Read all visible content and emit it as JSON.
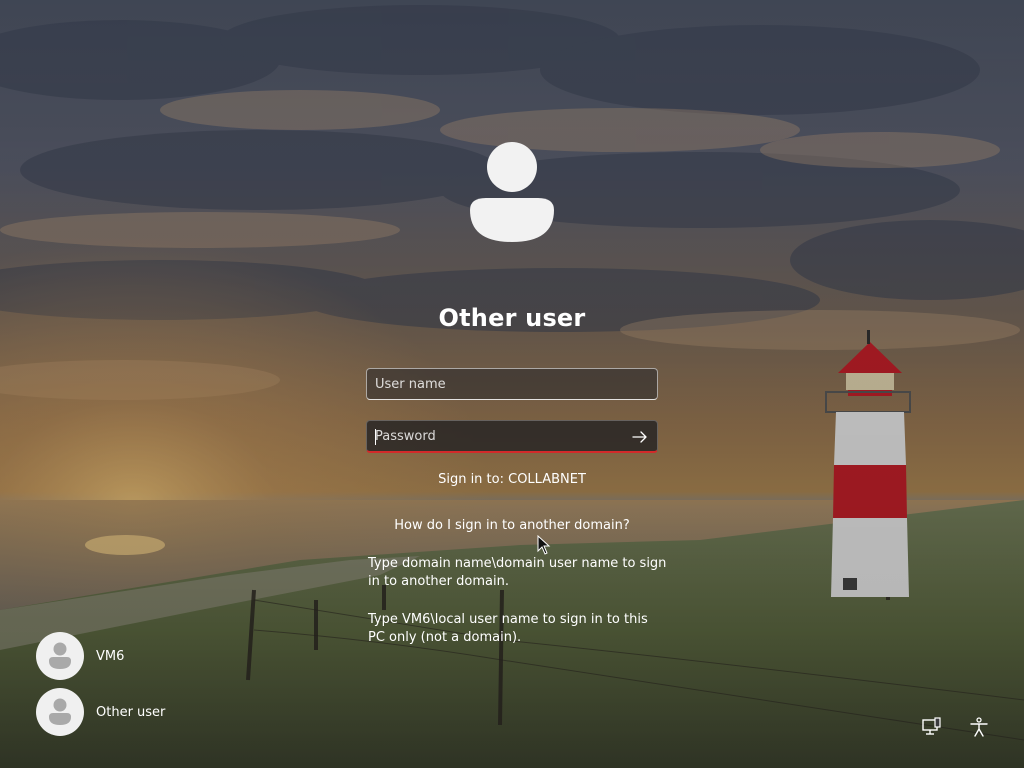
{
  "login": {
    "title": "Other user",
    "username_placeholder": "User name",
    "password_placeholder": "Password",
    "signin_to": "Sign in to: COLLABNET",
    "help_link": "How do I sign in to another domain?",
    "help_text_1": "Type domain name\\domain user name to sign in to another domain.",
    "help_text_2": "Type VM6\\local user name to sign in to this PC only (not a domain)."
  },
  "users": [
    {
      "name": "VM6"
    },
    {
      "name": "Other user"
    }
  ],
  "icons": {
    "submit": "arrow-right-icon",
    "network": "network-icon",
    "accessibility": "accessibility-icon"
  },
  "colors": {
    "password_underline": "#d32a2a",
    "lighthouse_red": "#c8202a"
  }
}
